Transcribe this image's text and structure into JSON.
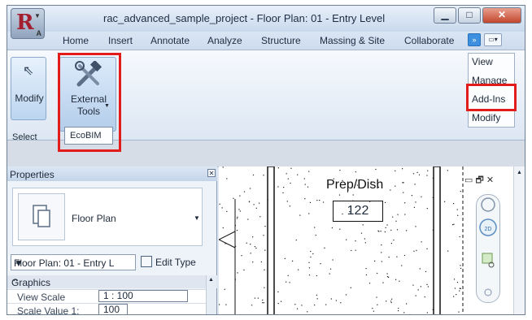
{
  "window": {
    "title": "rac_advanced_sample_project - Floor Plan: 01 - Entry Level",
    "controls": {
      "minimize": "▁",
      "maximize": "□",
      "close": "✕"
    }
  },
  "app_menu": {
    "logo": "R",
    "label": "A"
  },
  "tabs": [
    {
      "label": "Home"
    },
    {
      "label": "Insert"
    },
    {
      "label": "Annotate"
    },
    {
      "label": "Analyze"
    },
    {
      "label": "Structure"
    },
    {
      "label": "Massing & Site"
    },
    {
      "label": "Collaborate"
    }
  ],
  "ribbon": {
    "modify_label": "Modify",
    "select_label": "Select",
    "external_tools_label_1": "External",
    "external_tools_label_2": "Tools",
    "dropdown_item": "EcoBIM"
  },
  "overflow_tabs": [
    {
      "label": "View"
    },
    {
      "label": "Manage"
    },
    {
      "label": "Add-Ins"
    },
    {
      "label": "Modify"
    }
  ],
  "properties": {
    "title": "Properties",
    "type_name": "Floor Plan",
    "instance_selector": "Floor Plan: 01 - Entry L",
    "edit_type_label": "Edit Type",
    "group": "Graphics",
    "params": [
      {
        "name": "View Scale",
        "value": "1 : 100"
      },
      {
        "name": "Scale Value    1:",
        "value": "100"
      }
    ]
  },
  "canvas": {
    "room_name": "Prep/Dish",
    "room_number": "122",
    "view_controls": "▭ 🗗 ✕"
  },
  "colors": {
    "highlight_box": "#e21b1b",
    "tab_expander": "#3d8fe0",
    "app_logo": "#a31f2f"
  }
}
